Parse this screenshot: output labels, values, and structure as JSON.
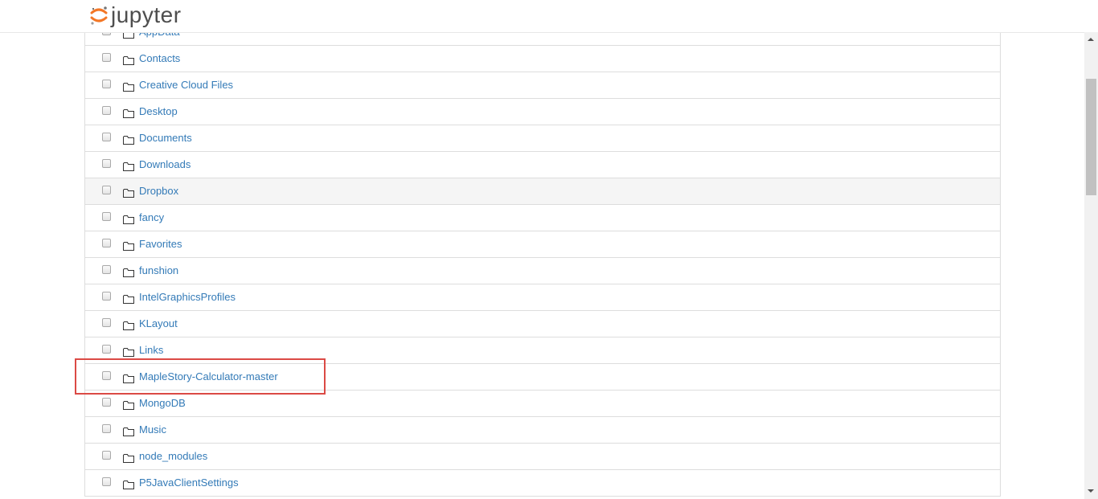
{
  "header": {
    "logo_text": "jupyter",
    "logo_icon": "jupyter-logo-icon"
  },
  "file_list": {
    "rows": [
      {
        "name": "AppData",
        "type": "folder",
        "icon": "folder-icon"
      },
      {
        "name": "Contacts",
        "type": "folder",
        "icon": "folder-icon"
      },
      {
        "name": "Creative Cloud Files",
        "type": "folder",
        "icon": "folder-icon"
      },
      {
        "name": "Desktop",
        "type": "folder",
        "icon": "folder-icon"
      },
      {
        "name": "Documents",
        "type": "folder",
        "icon": "folder-icon"
      },
      {
        "name": "Downloads",
        "type": "folder",
        "icon": "folder-icon"
      },
      {
        "name": "Dropbox",
        "type": "folder",
        "icon": "folder-icon",
        "hovered": true
      },
      {
        "name": "fancy",
        "type": "folder",
        "icon": "folder-icon"
      },
      {
        "name": "Favorites",
        "type": "folder",
        "icon": "folder-icon"
      },
      {
        "name": "funshion",
        "type": "folder",
        "icon": "folder-icon"
      },
      {
        "name": "IntelGraphicsProfiles",
        "type": "folder",
        "icon": "folder-icon"
      },
      {
        "name": "KLayout",
        "type": "folder",
        "icon": "folder-icon"
      },
      {
        "name": "Links",
        "type": "folder",
        "icon": "folder-icon"
      },
      {
        "name": "MapleStory-Calculator-master",
        "type": "folder",
        "icon": "folder-icon",
        "highlighted": true
      },
      {
        "name": "MongoDB",
        "type": "folder",
        "icon": "folder-icon"
      },
      {
        "name": "Music",
        "type": "folder",
        "icon": "folder-icon"
      },
      {
        "name": "node_modules",
        "type": "folder",
        "icon": "folder-icon"
      },
      {
        "name": "P5JavaClientSettings",
        "type": "folder",
        "icon": "folder-icon"
      }
    ]
  },
  "colors": {
    "link": "#337ab7",
    "highlight_border": "#db4a45",
    "logo_orange": "#f37726",
    "logo_text": "#4e4e4e"
  }
}
